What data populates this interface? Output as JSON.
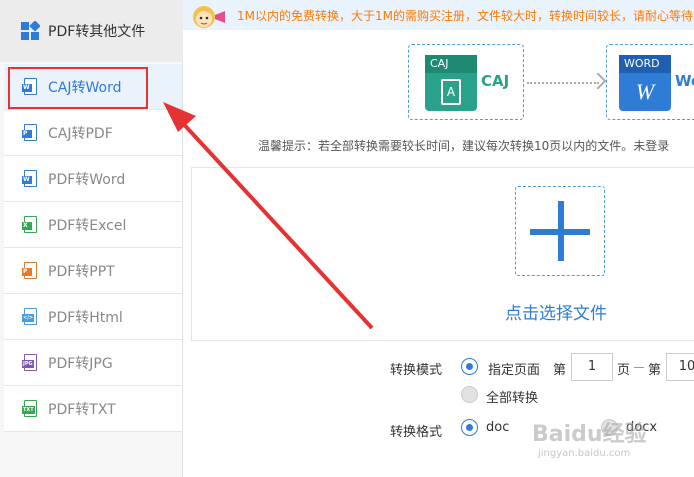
{
  "sidebar": {
    "header_title": "PDF转其他文件",
    "items": [
      {
        "label": "CAJ转Word",
        "tag": "W",
        "color": "#2e7cd6"
      },
      {
        "label": "CAJ转PDF",
        "tag": "P",
        "color": "#2e7cd6"
      },
      {
        "label": "PDF转Word",
        "tag": "W",
        "color": "#2e7cd6"
      },
      {
        "label": "PDF转Excel",
        "tag": "X",
        "color": "#3aa655"
      },
      {
        "label": "PDF转PPT",
        "tag": "P",
        "color": "#e07a2e"
      },
      {
        "label": "PDF转Html",
        "tag": "</>",
        "color": "#4a9be0"
      },
      {
        "label": "PDF转JPG",
        "tag": "JPG",
        "color": "#7b5ab0"
      },
      {
        "label": "PDF转TXT",
        "tag": "TXT",
        "color": "#3aa655"
      }
    ]
  },
  "notice": {
    "text": "1M以内的免费转换，大于1M的需购买注册，文件较大时，转换时间较长，请耐心等待"
  },
  "flow": {
    "source_tag": "CAJ",
    "source_label": "CAJ",
    "source_glyph": "A",
    "target_tag": "WORD",
    "target_label": "Wo",
    "target_glyph": "W"
  },
  "tip": "温馨提示：若全部转换需要较长时间，建议每次转换10页以内的文件。未登录",
  "upload": {
    "choose_label": "点击选择文件"
  },
  "options": {
    "mode_label": "转换模式",
    "specified_pages": "指定页面",
    "page_prefix": "第",
    "page_from": "1",
    "page_suffix": "页",
    "page_prefix2": "第",
    "page_to": "10",
    "all_pages": "全部转换",
    "format_label": "转换格式",
    "format_doc": "doc",
    "format_docx": "docx"
  },
  "watermark": {
    "main": "Baidu经验",
    "sub": "jingyan.baidu.com"
  },
  "colors": {
    "accent": "#2e7cd6",
    "highlight_red": "#e53333",
    "notice_text": "#ff7a00",
    "caj_green": "#2aa18a"
  }
}
